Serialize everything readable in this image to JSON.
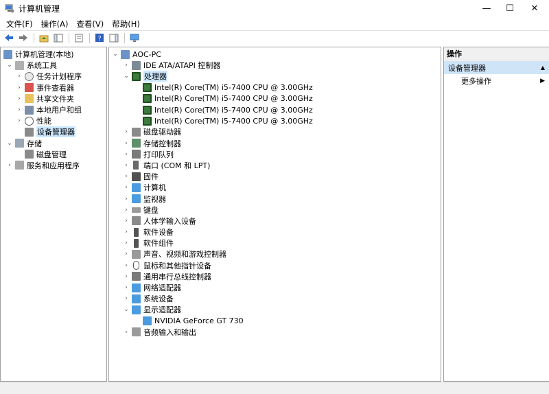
{
  "window": {
    "title": "计算机管理",
    "minimize": "—",
    "maximize": "☐",
    "close": "✕"
  },
  "menu": [
    "文件(F)",
    "操作(A)",
    "查看(V)",
    "帮助(H)"
  ],
  "left_tree": {
    "root": "计算机管理(本地)",
    "system_tools": "系统工具",
    "items": [
      "任务计划程序",
      "事件查看器",
      "共享文件夹",
      "本地用户和组",
      "性能",
      "设备管理器"
    ],
    "storage": "存储",
    "disk_mgmt": "磁盘管理",
    "services": "服务和应用程序"
  },
  "device_tree": {
    "computer": "AOC-PC",
    "ide": "IDE ATA/ATAPI 控制器",
    "processor": "处理器",
    "cpus": [
      "Intel(R) Core(TM) i5-7400 CPU @ 3.00GHz",
      "Intel(R) Core(TM) i5-7400 CPU @ 3.00GHz",
      "Intel(R) Core(TM) i5-7400 CPU @ 3.00GHz",
      "Intel(R) Core(TM) i5-7400 CPU @ 3.00GHz"
    ],
    "categories": [
      "磁盘驱动器",
      "存储控制器",
      "打印队列",
      "端口 (COM 和 LPT)",
      "固件",
      "计算机",
      "监视器",
      "键盘",
      "人体学输入设备",
      "软件设备",
      "软件组件",
      "声音、视频和游戏控制器",
      "鼠标和其他指针设备",
      "通用串行总线控制器",
      "网络适配器",
      "系统设备"
    ],
    "display": "显示适配器",
    "gpu": "NVIDIA GeForce GT 730",
    "audio_io": "音频输入和输出"
  },
  "actions": {
    "header": "操作",
    "section": "设备管理器",
    "more": "更多操作"
  },
  "colors": {
    "selection": "#cce8ff",
    "section_bg": "#cfe4f7"
  }
}
